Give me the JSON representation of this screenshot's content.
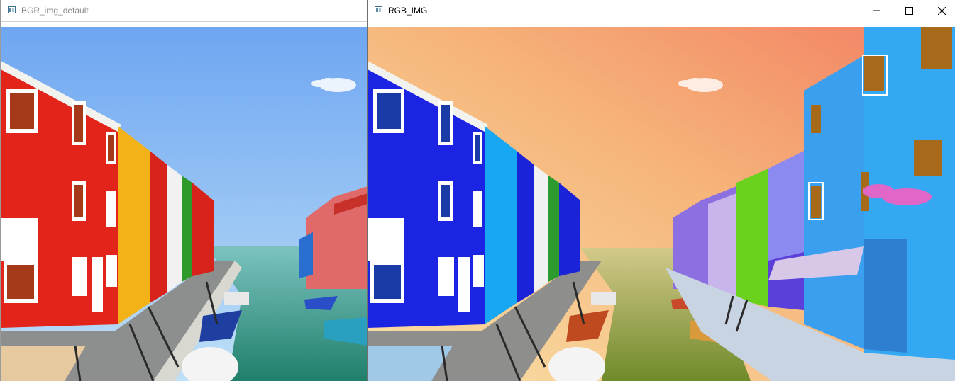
{
  "windows": [
    {
      "title": "BGR_img_default",
      "active": false,
      "colors": {
        "sky_top": "#6ea6f2",
        "sky_bottom": "#bfe0f6",
        "bldg_main": "#e3241b",
        "bldg_dark": "#c01a12",
        "bldg_yellow": "#f3b318",
        "bldg_red2": "#d8231a",
        "bldg_green": "#2e9a2c",
        "bldg_right_pink": "#e06a6a",
        "bldg_right_red": "#c8302a",
        "water": "#2f8f8a",
        "water_light": "#7cc3c0",
        "walk": "#8d8f8e",
        "walk_light": "#e7c9a0"
      }
    },
    {
      "title": "RGB_IMG",
      "active": true,
      "colors": {
        "sky_top": "#f39a63",
        "sky_bottom": "#f7d79a",
        "bldg_main": "#1b24e3",
        "bldg_dark": "#121ac0",
        "bldg_yellow": "#18b3f3",
        "bldg_red2": "#1a23d8",
        "bldg_green": "#2c9a2e",
        "bldg_right_pink": "#6a6ae0",
        "bldg_right_red": "#2a30c8",
        "bldg_right_blue": "#3b9ff0",
        "bldg_right_lime": "#6ad21c",
        "water": "#8a8f2f",
        "water_light": "#c0c37c",
        "walk": "#8e8f8d",
        "walk_light": "#a0c9e7"
      }
    }
  ],
  "window_buttons": {
    "minimize_icon": "minimize-icon",
    "maximize_icon": "maximize-icon",
    "close_icon": "close-icon"
  }
}
